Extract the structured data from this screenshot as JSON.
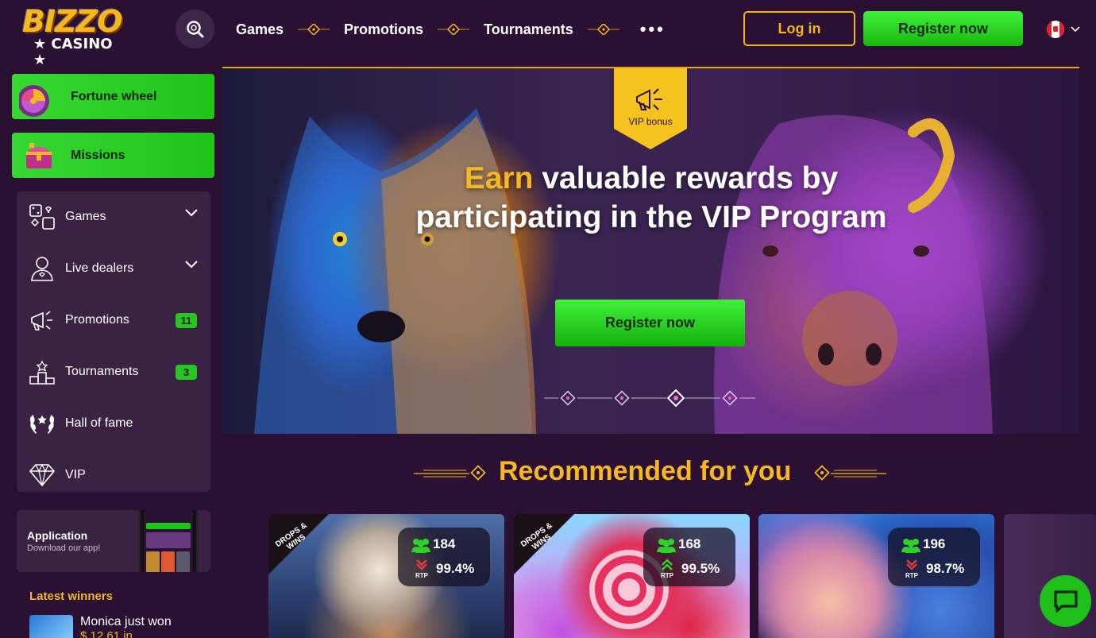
{
  "header": {
    "logo_top": "BIZZO",
    "logo_bottom": "★ CASINO ★",
    "nav": [
      "Games",
      "Promotions",
      "Tournaments"
    ],
    "more": "•••",
    "login": "Log in",
    "register": "Register now"
  },
  "sidebar": {
    "fortune_wheel": "Fortune wheel",
    "missions": "Missions",
    "items": [
      {
        "label": "Games",
        "icon": "games-icon"
      },
      {
        "label": "Live dealers",
        "icon": "live-dealer-icon"
      },
      {
        "label": "Promotions",
        "icon": "megaphone-icon",
        "badge": "11"
      },
      {
        "label": "Tournaments",
        "icon": "podium-icon",
        "badge": "3"
      },
      {
        "label": "Hall of fame",
        "icon": "laurel-icon"
      },
      {
        "label": "VIP",
        "icon": "diamond-icon"
      }
    ],
    "app": {
      "title": "Application",
      "subtitle": "Download our app!"
    },
    "latest_winners_title": "Latest winners",
    "winner": {
      "text": "Monica just won",
      "amount": "$ 12.61 in"
    }
  },
  "hero": {
    "tag": "VIP bonus",
    "title_highlight": "Earn",
    "title_rest": " valuable rewards by participating in the VIP Program",
    "cta": "Register now"
  },
  "recommended": {
    "title": "Recommended for you",
    "games": [
      {
        "ribbon": "DROPS & WINS",
        "players": "184",
        "rtp": "99.4%",
        "trend": "down"
      },
      {
        "ribbon": "DROPS & WINS",
        "players": "168",
        "rtp": "99.5%",
        "trend": "up"
      },
      {
        "ribbon": "",
        "players": "196",
        "rtp": "98.7%",
        "trend": "down"
      }
    ],
    "rtp_label": "RTP"
  },
  "colors": {
    "accent": "#f5b722",
    "green": "#1ec419",
    "bg": "#2a1033"
  }
}
